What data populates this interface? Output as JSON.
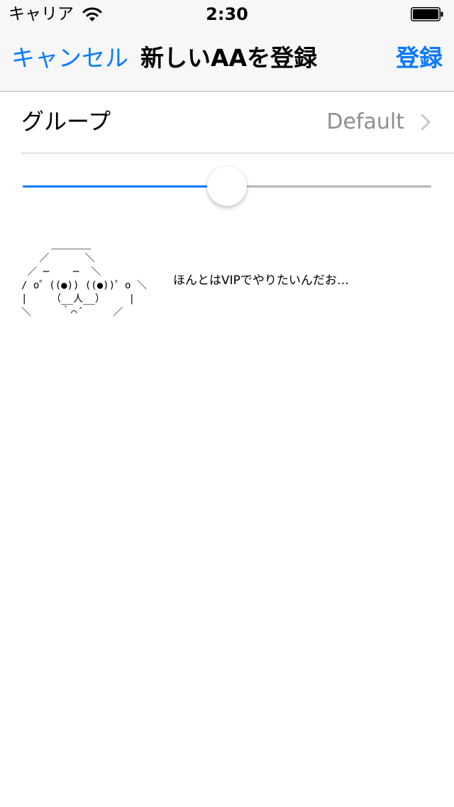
{
  "status_bar": {
    "carrier": "キャリア",
    "time": "2:30",
    "battery_level": 1.0
  },
  "nav_bar": {
    "cancel_label": "キャンセル",
    "title": "新しいAAを登録",
    "register_label": "登録"
  },
  "group_row": {
    "label": "グループ",
    "value": "Default"
  },
  "slider": {
    "value": 0.5
  },
  "preview": {
    "aa": "     ＿＿＿＿\n   ／      ＼\n ／ ─    ─  ＼\n/ o゜((●)) ((●))゜o ＼\n|    （__人__）    |\n＼     ｀⌒´     ／",
    "caption": "ほんとはVIPでやりたいんだお…"
  },
  "colors": {
    "accent": "#0a7aff",
    "secondary_text": "#8e8e93",
    "header_bg": "#f7f7f8",
    "separator": "#c8c7cc"
  }
}
